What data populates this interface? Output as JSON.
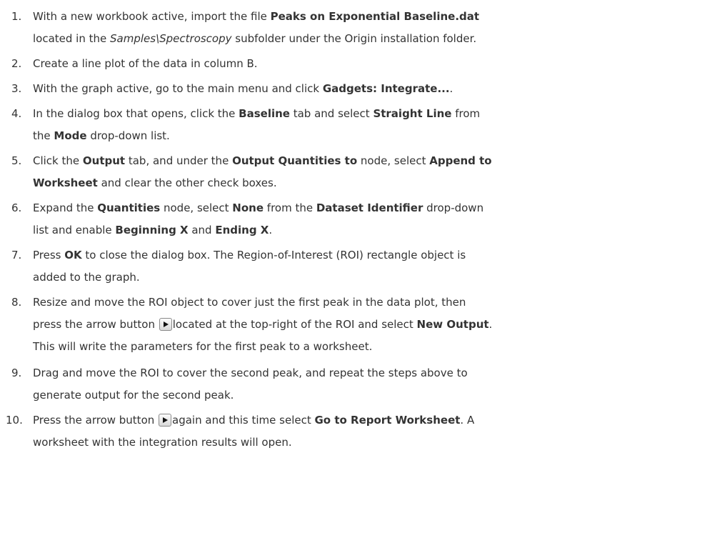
{
  "steps": [
    {
      "number": "1.",
      "lines": [
        [
          {
            "t": "With a new workbook active, import the file "
          },
          {
            "t": "Peaks on Exponential Baseline.dat",
            "b": true
          }
        ],
        [
          {
            "t": "located in the "
          },
          {
            "t": "Samples\\Spectroscopy",
            "i": true
          },
          {
            "t": " subfolder under the Origin installation folder."
          }
        ]
      ]
    },
    {
      "number": "2.",
      "lines": [
        [
          {
            "t": "Create a line plot of the data in column B."
          }
        ]
      ]
    },
    {
      "number": "3.",
      "lines": [
        [
          {
            "t": "With the graph active, go to the main menu and click "
          },
          {
            "t": "Gadgets: Integrate...",
            "b": true
          },
          {
            "t": "."
          }
        ]
      ]
    },
    {
      "number": "4.",
      "lines": [
        [
          {
            "t": "In the dialog box that opens, click the "
          },
          {
            "t": "Baseline",
            "b": true
          },
          {
            "t": " tab and select "
          },
          {
            "t": "Straight Line",
            "b": true
          },
          {
            "t": " from"
          }
        ],
        [
          {
            "t": "the "
          },
          {
            "t": "Mode",
            "b": true
          },
          {
            "t": " drop-down list."
          }
        ]
      ]
    },
    {
      "number": "5.",
      "lines": [
        [
          {
            "t": "Click the "
          },
          {
            "t": "Output",
            "b": true
          },
          {
            "t": " tab, and under the "
          },
          {
            "t": "Output Quantities to",
            "b": true
          },
          {
            "t": " node, select "
          },
          {
            "t": "Append to",
            "b": true
          }
        ],
        [
          {
            "t": "Worksheet",
            "b": true
          },
          {
            "t": " and clear the other check boxes."
          }
        ]
      ]
    },
    {
      "number": "6.",
      "lines": [
        [
          {
            "t": "Expand the "
          },
          {
            "t": "Quantities",
            "b": true
          },
          {
            "t": " node, select "
          },
          {
            "t": "None",
            "b": true
          },
          {
            "t": " from the "
          },
          {
            "t": "Dataset Identifier",
            "b": true
          },
          {
            "t": " drop-down"
          }
        ],
        [
          {
            "t": "list and enable "
          },
          {
            "t": "Beginning X",
            "b": true
          },
          {
            "t": " and "
          },
          {
            "t": "Ending X",
            "b": true
          },
          {
            "t": "."
          }
        ]
      ]
    },
    {
      "number": "7.",
      "lines": [
        [
          {
            "t": "Press "
          },
          {
            "t": "OK",
            "b": true
          },
          {
            "t": " to close the dialog box. The Region-of-Interest (ROI) rectangle object is"
          }
        ],
        [
          {
            "t": "added to the graph."
          }
        ]
      ]
    },
    {
      "number": "8.",
      "tall": true,
      "lines": [
        [
          {
            "t": "Resize and move the ROI object to cover just the first peak in the data plot, then"
          }
        ],
        [
          {
            "t": "press the arrow button "
          },
          {
            "icon": "play-arrow-button-icon"
          },
          {
            "t": "located at the top-right of the ROI and select "
          },
          {
            "t": "New Output",
            "b": true
          },
          {
            "t": "."
          }
        ],
        [
          {
            "t": "This will write the parameters for the first peak to a worksheet."
          }
        ]
      ]
    },
    {
      "number": "9.",
      "lines": [
        [
          {
            "t": "Drag and move the ROI to cover the second peak, and repeat the steps above to"
          }
        ],
        [
          {
            "t": "generate output for the second peak."
          }
        ]
      ]
    },
    {
      "number": "10.",
      "tall": true,
      "lines": [
        [
          {
            "t": "Press the arrow button "
          },
          {
            "icon": "play-arrow-button-icon"
          },
          {
            "t": "again and this time select "
          },
          {
            "t": "Go to Report Worksheet",
            "b": true
          },
          {
            "t": ". A"
          }
        ],
        [
          {
            "t": "worksheet with the integration results will open."
          }
        ]
      ]
    }
  ]
}
